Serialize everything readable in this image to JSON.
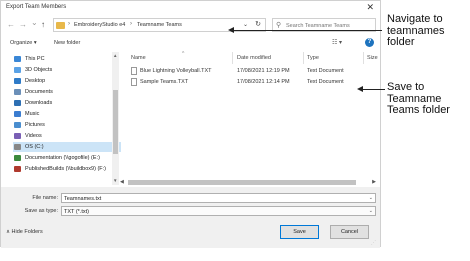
{
  "dialog": {
    "title": "Export Team Members",
    "close_glyph": "✕"
  },
  "nav": {
    "back_glyph": "←",
    "forward_glyph": "→",
    "recent_glyph": "⌄",
    "up_glyph": "↑",
    "breadcrumb": [
      "EmbroideryStudio e4",
      "Teamname Teams"
    ],
    "separator_glyph": "›",
    "dropdown_glyph": "⌄",
    "refresh_glyph": "↻",
    "search_placeholder": "Search Teamname Teams",
    "search_glyph": "⚲"
  },
  "toolbar": {
    "organize_label": "Organize ▾",
    "new_folder_label": "New folder",
    "view_glyph": "☷ ▾",
    "help_glyph": "?"
  },
  "sidebar": {
    "items": [
      {
        "label": "This PC",
        "icon": "computer-icon",
        "color": "#3a87d6"
      },
      {
        "label": "3D Objects",
        "icon": "cube-icon",
        "color": "#5aa2e6"
      },
      {
        "label": "Desktop",
        "icon": "desktop-icon",
        "color": "#2f7bc8"
      },
      {
        "label": "Documents",
        "icon": "documents-icon",
        "color": "#6b8fb8"
      },
      {
        "label": "Downloads",
        "icon": "download-icon",
        "color": "#2d6fb3"
      },
      {
        "label": "Music",
        "icon": "music-icon",
        "color": "#3b7dd0"
      },
      {
        "label": "Pictures",
        "icon": "pictures-icon",
        "color": "#4a8ecf"
      },
      {
        "label": "Videos",
        "icon": "videos-icon",
        "color": "#7a5fb5"
      },
      {
        "label": "OS (C:)",
        "icon": "drive-icon",
        "color": "#888888"
      },
      {
        "label": "Documentation (\\\\gogofile) (E:)",
        "icon": "network-drive-icon",
        "color": "#3c8a3c"
      },
      {
        "label": "PublishedBuilds (\\\\buildbox9) (F:)",
        "icon": "network-drive-icon",
        "color": "#b03a2e"
      }
    ],
    "selected_index": 8
  },
  "files": {
    "columns": [
      "Name",
      "Date modified",
      "Type",
      "Size"
    ],
    "sort_glyph": "^",
    "rows": [
      {
        "name": "Blue Lightning Volleyball.TXT",
        "date": "17/08/2021 12:19 PM",
        "type": "Text Document"
      },
      {
        "name": "Sample Teams.TXT",
        "date": "17/08/2021 12:14 PM",
        "type": "Text Document"
      }
    ]
  },
  "scroll": {
    "up_glyph": "▲",
    "down_glyph": "▼",
    "left_glyph": "◀",
    "right_glyph": "▶"
  },
  "bottom": {
    "filename_label": "File name:",
    "filename_value": "Teamnames.txt",
    "savetype_label": "Save as type:",
    "savetype_value": "TXT (*.txt)",
    "dropdown_glyph": "⌄",
    "hide_folders_label": "∧ Hide Folders",
    "save_label": "Save",
    "cancel_label": "Cancel",
    "grip_glyph": "⋰"
  },
  "callouts": [
    {
      "text": "Navigate to\nteamnames\nfolder"
    },
    {
      "text": "Save to\nTeamname\nTeams folder"
    }
  ]
}
